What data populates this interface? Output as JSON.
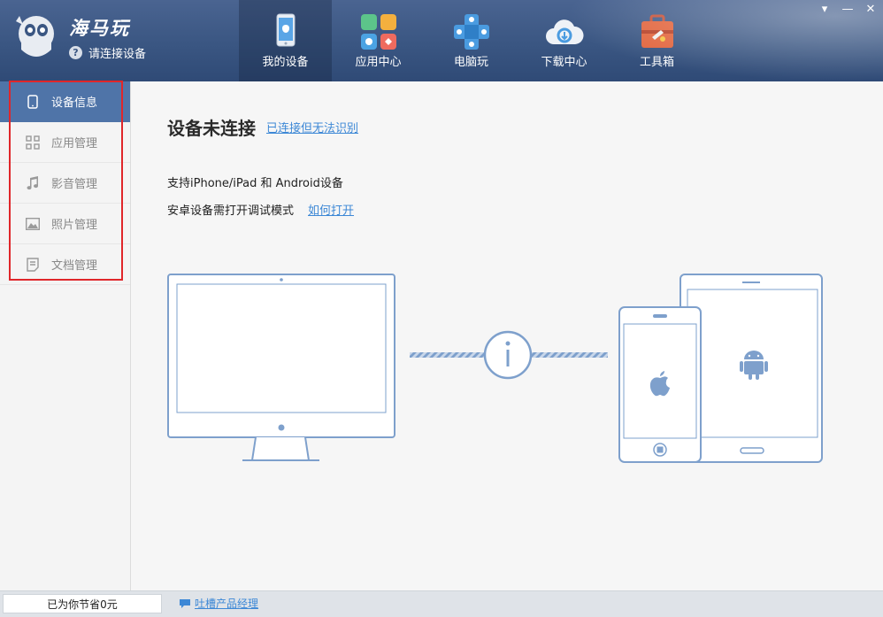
{
  "header": {
    "brand": "海马玩",
    "connect_hint": "请连接设备",
    "tabs": [
      {
        "label": "我的设备",
        "icon": "phone-icon",
        "active": true
      },
      {
        "label": "应用中心",
        "icon": "app-center-icon"
      },
      {
        "label": "电脑玩",
        "icon": "gamepad-icon"
      },
      {
        "label": "下载中心",
        "icon": "cloud-download-icon"
      },
      {
        "label": "工具箱",
        "icon": "toolbox-icon"
      }
    ],
    "window_controls": {
      "menu": "▾",
      "minimize": "—",
      "close": "✕"
    }
  },
  "sidebar": {
    "items": [
      {
        "label": "设备信息",
        "icon": "phone-outline-icon",
        "active": true
      },
      {
        "label": "应用管理",
        "icon": "grid-icon"
      },
      {
        "label": "影音管理",
        "icon": "music-note-icon"
      },
      {
        "label": "照片管理",
        "icon": "photo-icon"
      },
      {
        "label": "文档管理",
        "icon": "document-icon"
      }
    ]
  },
  "main": {
    "title": "设备未连接",
    "title_link": "已连接但无法识别",
    "support_text": "支持iPhone/iPad 和 Android设备",
    "android_hint": "安卓设备需打开调试模式",
    "how_link": "如何打开"
  },
  "footer": {
    "saved_text": "已为你节省0元",
    "feedback_link": "吐槽产品经理"
  },
  "colors": {
    "header": "#3a5682",
    "sidebar_active": "#4f74a8",
    "link": "#3d88d6",
    "illustration": "#7ea0cc",
    "highlight_box": "#e0262a"
  }
}
